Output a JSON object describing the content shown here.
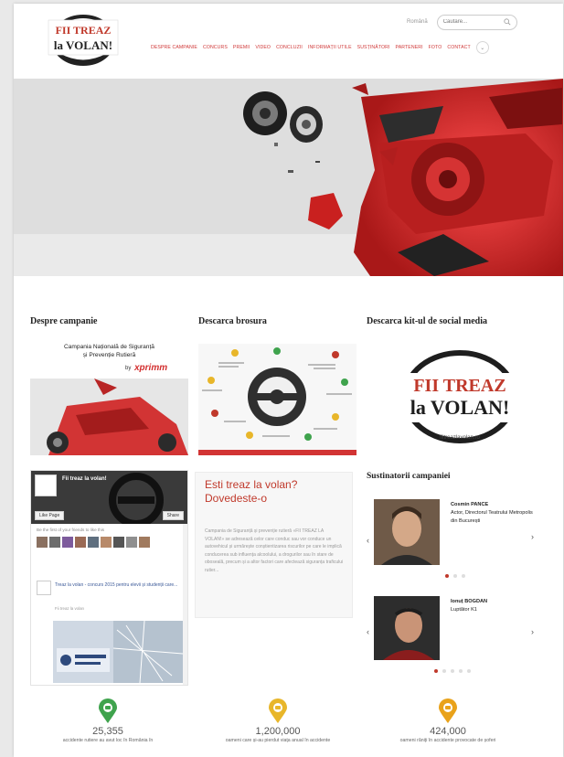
{
  "header": {
    "logo_text": {
      "line1": "FII TREAZ",
      "line2": "la VOLAN!"
    },
    "lang_label": "Română",
    "search_placeholder": "Căutare...",
    "nav": [
      "DESPRE CAMPANIE",
      "CONCURS",
      "PREMII",
      "VIDEO",
      "CONCLUZII",
      "INFORMAȚII UTILE",
      "SUSȚINĂTORI",
      "PARTENERI",
      "FOTO",
      "CONTACT"
    ],
    "nav_more_icon": "chevron-down-icon"
  },
  "columns": {
    "about": {
      "title": "Despre campanie",
      "caption_line1": "Campania Națională de Siguranță",
      "caption_line2": "și Prevenție Rutieră",
      "sponsor_prefix": "by",
      "sponsor": "xprimm"
    },
    "brochure": {
      "title": "Descarca brosura"
    },
    "kit": {
      "title": "Descarca kit-ul de social media",
      "logo_line1": "FII TREAZ",
      "logo_line2": "la VOLAN!",
      "logo_url": "fiitreazlavolan.ro"
    }
  },
  "facebook": {
    "page_name": "Fii treaz la volan!",
    "like_label": "Like Page",
    "share_label": "Share",
    "friends_text": "Be the first of your friends to like this",
    "post_title": "Treaz la volan - concurs 2015 pentru elevii și studenții care...",
    "post_sub": "Fii treaz la volan"
  },
  "promo": {
    "title_line1": "Esti treaz la volan?",
    "title_line2": "Dovedeste-o",
    "body": "Campania de Siguranță și prevenție rutieră «FII TREAZ LA VOLAN!» se adresează celor care conduc sau vor conduce un autovehicul și urmărește conștientizarea riscurilor pe care le implică conducerea sub influența alcoolului, a drogurilor sau în stare de oboseală, precum și a altor factori care afectează siguranța traficului rutier..."
  },
  "supporters": {
    "title": "Sustinatorii campaniei",
    "people": [
      {
        "name": "Cosmin PANCE",
        "role": "Actor, Directorul Teatrului Metropolis din București"
      },
      {
        "name": "Ionuț BOGDAN",
        "role": "Luptător K1"
      }
    ]
  },
  "stats": [
    {
      "value": "25,355",
      "label": "accidente rutiere au avut loc în România în"
    },
    {
      "value": "1,200,000",
      "label": "oameni care și-au pierdut viața anual în accidente"
    },
    {
      "value": "424,000",
      "label": "oameni răniți în accidente provocate de șoferi"
    }
  ],
  "colors": {
    "brand_red": "#c0392b",
    "nav_red": "#d03a3a",
    "pin_green": "#3fa34d",
    "pin_yellow": "#e8b62a",
    "pin_orange": "#e9a21a"
  }
}
